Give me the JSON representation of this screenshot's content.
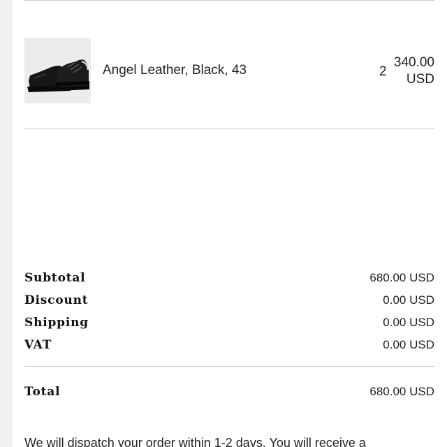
{
  "order_item": {
    "image_alt": "black leather sneaker",
    "name": "Angel Leather, Black, 43",
    "quantity": "2",
    "price_amount": "340.00",
    "price_currency": "USD"
  },
  "summary": {
    "rows": [
      {
        "label": "Subtotal",
        "value": "680.00 USD"
      },
      {
        "label": "Discount",
        "value": "0.00 USD"
      },
      {
        "label": "Shipping",
        "value": "0.00 USD"
      },
      {
        "label": "VAT",
        "value": "0.00 USD"
      }
    ],
    "total_label": "Total",
    "total_value": "680.00 USD"
  },
  "dispatch_text": "We will dispatch your order within 1-2 days. You will receive a"
}
